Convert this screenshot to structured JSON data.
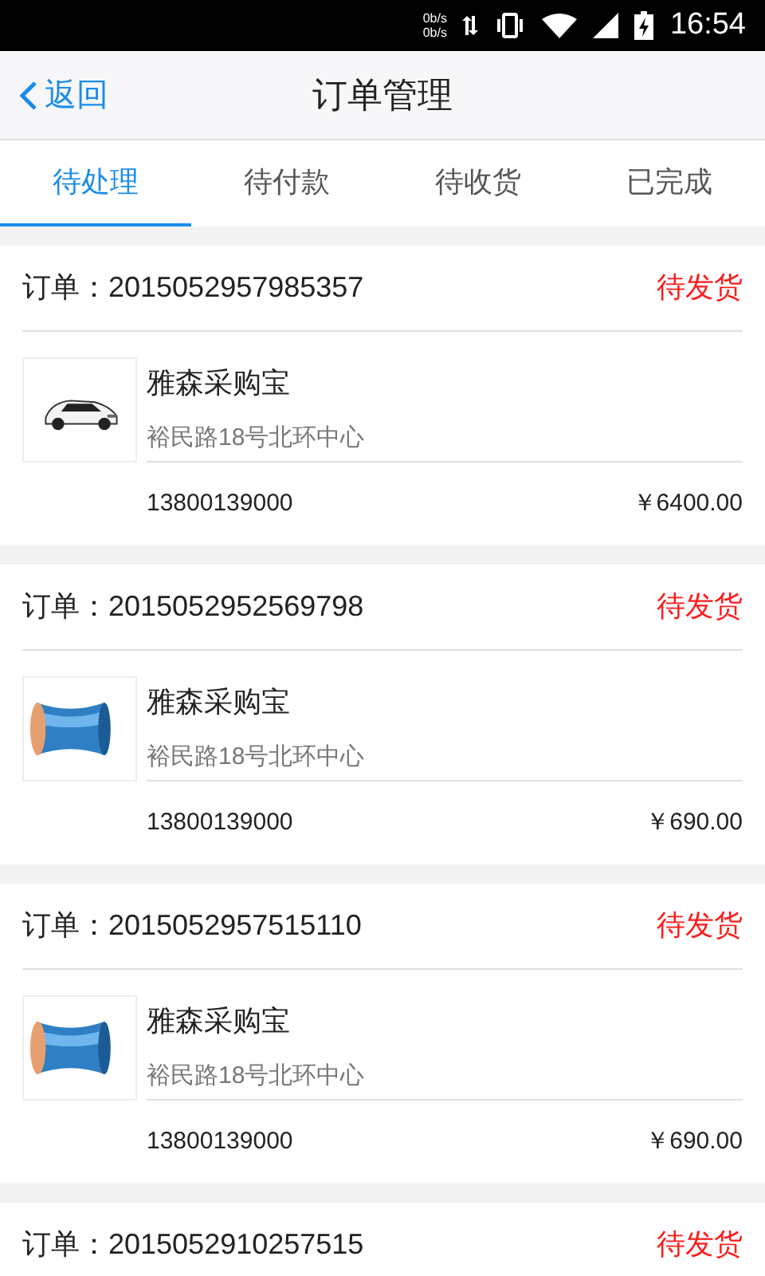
{
  "status_bar": {
    "net_up": "0b/s",
    "net_down": "0b/s",
    "time": "16:54"
  },
  "header": {
    "back": "返回",
    "title": "订单管理"
  },
  "tabs": [
    {
      "label": "待处理",
      "selected": true
    },
    {
      "label": "待付款",
      "selected": false
    },
    {
      "label": "待收货",
      "selected": false
    },
    {
      "label": "已完成",
      "selected": false
    }
  ],
  "orders": [
    {
      "label": "订单：",
      "number": "2015052957985357",
      "status": "待发货",
      "shop": "雅森采购宝",
      "address": "裕民路18号北环中心",
      "phone": "13800139000",
      "price": "￥6400.00"
    },
    {
      "label": "订单：",
      "number": "2015052952569798",
      "status": "待发货",
      "shop": "雅森采购宝",
      "address": "裕民路18号北环中心",
      "phone": "13800139000",
      "price": "￥690.00"
    },
    {
      "label": "订单：",
      "number": "2015052957515110",
      "status": "待发货",
      "shop": "雅森采购宝",
      "address": "裕民路18号北环中心",
      "phone": "13800139000",
      "price": "￥690.00"
    },
    {
      "label": "订单：",
      "number": "2015052910257515",
      "status": "待发货"
    }
  ]
}
